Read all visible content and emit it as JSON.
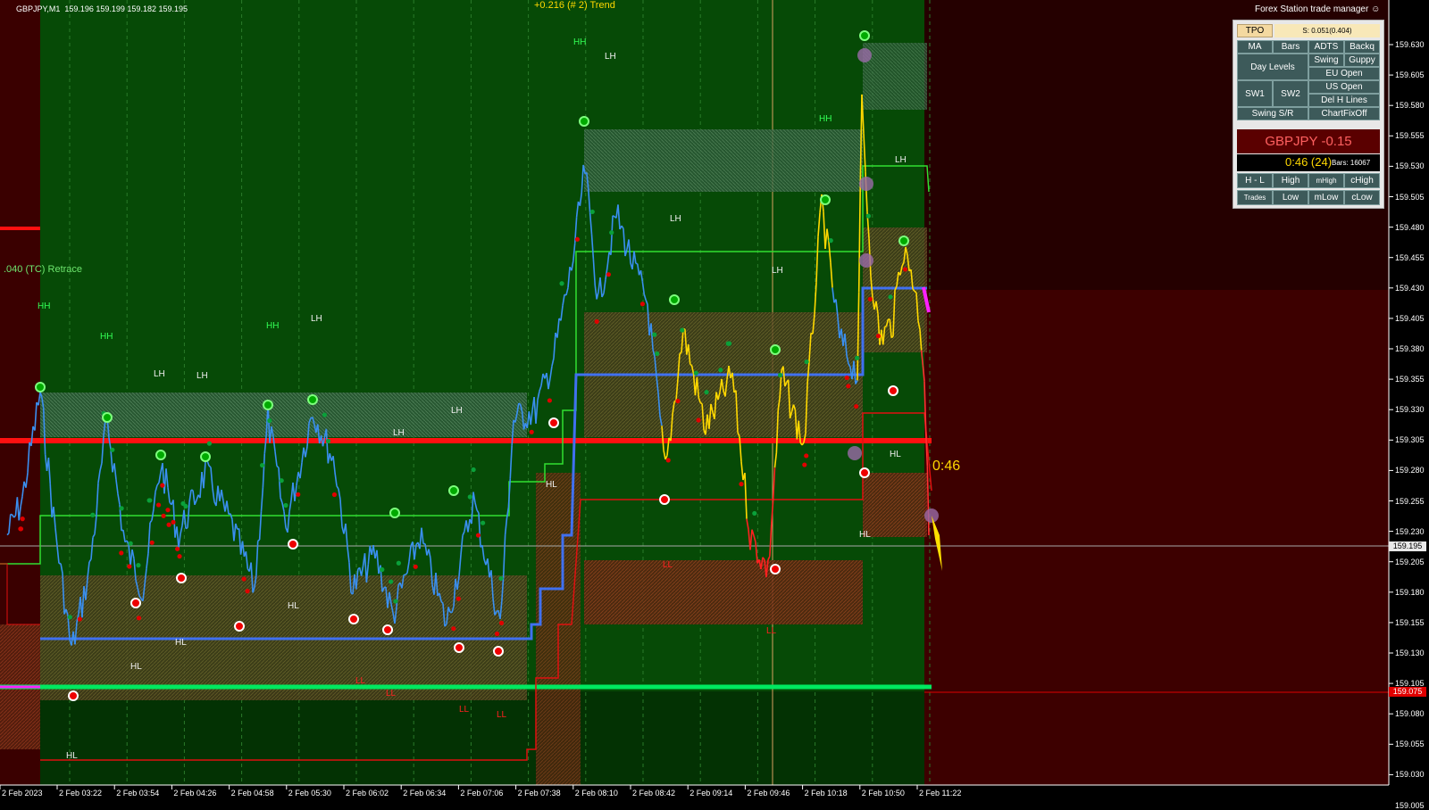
{
  "header": {
    "symbol_info": "GBPJPY,M1  159.196 159.199 159.182 159.195",
    "trend_label": "+0.216 (# 2) Trend",
    "retrace_label": ".040 (TC) Retrace",
    "countdown": "0:46"
  },
  "trade_manager": {
    "title": "Forex Station trade manager",
    "row1": {
      "tpo": "TPO",
      "spread_info": "S: 0.051(0.404)"
    },
    "buttons": {
      "ma": "MA",
      "bars": "Bars",
      "adts": "ADTS",
      "backq": "Backq",
      "day_levels": "Day Levels",
      "swing": "Swing",
      "guppy": "Guppy",
      "eu_open": "EU Open",
      "sw1": "SW1",
      "sw2": "SW2",
      "us_open": "US Open",
      "del_h_lines": "Del H Lines",
      "swing_sr": "Swing S/R",
      "chartfixoff": "ChartFixOff",
      "h_l": "H - L",
      "high": "High",
      "mhigh": "mHigh",
      "chigh": "cHigh",
      "trades": "Trades",
      "low": "Low",
      "mlow": "mLow",
      "clow": "cLow"
    },
    "symbol_change": "GBPJPY -0.15",
    "timer": "0:46 (24)",
    "bars": "Bars: 16067"
  },
  "price_axis": {
    "labels": [
      "159.630",
      "159.605",
      "159.580",
      "159.555",
      "159.530",
      "159.505",
      "159.480",
      "159.455",
      "159.430",
      "159.405",
      "159.380",
      "159.355",
      "159.330",
      "159.305",
      "159.280",
      "159.255",
      "159.230",
      "159.205",
      "159.180",
      "159.155",
      "159.130",
      "159.105",
      "159.080",
      "159.055",
      "159.030",
      "159.005"
    ],
    "current_price": "159.195",
    "level_price": "159.075"
  },
  "time_axis": {
    "labels": [
      "2 Feb 2023",
      "2 Feb 03:22",
      "2 Feb 03:54",
      "2 Feb 04:26",
      "2 Feb 04:58",
      "2 Feb 05:30",
      "2 Feb 06:02",
      "2 Feb 06:34",
      "2 Feb 07:06",
      "2 Feb 07:38",
      "2 Feb 08:10",
      "2 Feb 08:42",
      "2 Feb 09:14",
      "2 Feb 09:46",
      "2 Feb 10:18",
      "2 Feb 10:50",
      "2 Feb 11:22"
    ]
  },
  "swing_labels": [
    {
      "text": "HH",
      "c": "g"
    },
    {
      "text": "LH",
      "c": "w"
    },
    {
      "text": "HH",
      "c": "g"
    },
    {
      "text": "LH",
      "c": "w"
    },
    {
      "text": "HH",
      "c": "g"
    },
    {
      "text": "HH",
      "c": "g"
    },
    {
      "text": "LH",
      "c": "w"
    },
    {
      "text": "LH",
      "c": "w"
    },
    {
      "text": "LH",
      "c": "w"
    },
    {
      "text": "LH",
      "c": "w"
    },
    {
      "text": "LH",
      "c": "w"
    },
    {
      "text": "HH",
      "c": "g"
    },
    {
      "text": "LH",
      "c": "w"
    },
    {
      "text": "LH",
      "c": "w"
    },
    {
      "text": "HH",
      "c": "g"
    },
    {
      "text": "LH",
      "c": "w"
    },
    {
      "text": "HL",
      "c": "w"
    },
    {
      "text": "HL",
      "c": "w"
    },
    {
      "text": "HL",
      "c": "w"
    },
    {
      "text": "HL",
      "c": "w"
    },
    {
      "text": "HL",
      "c": "w"
    },
    {
      "text": "HL",
      "c": "w"
    },
    {
      "text": "HL",
      "c": "w"
    },
    {
      "text": "LL",
      "c": "r"
    },
    {
      "text": "LL",
      "c": "r"
    },
    {
      "text": "LL",
      "c": "r"
    },
    {
      "text": "LL",
      "c": "r"
    },
    {
      "text": "LL",
      "c": "r"
    },
    {
      "text": "LL",
      "c": "r"
    }
  ]
}
